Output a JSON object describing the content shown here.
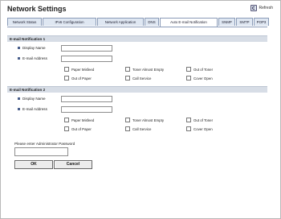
{
  "header": {
    "title": "Network Settings",
    "refresh_label": "Refresh"
  },
  "tabs": [
    {
      "label": "Network Status"
    },
    {
      "label": "IPv6 Configuration"
    },
    {
      "label": "Network Application"
    },
    {
      "label": "DNS"
    },
    {
      "label": "Auto E-mail Notification",
      "active": true
    },
    {
      "label": "SNMP"
    },
    {
      "label": "SMTP"
    },
    {
      "label": "POP3"
    }
  ],
  "notification1": {
    "title": "E-mail Notification 1",
    "display_name_label": "Display Name",
    "email_label": "E-mail Address",
    "display_name_value": "",
    "email_value": "",
    "options": {
      "paper_misfeed": "Paper Misfeed",
      "toner_almost_empty": "Toner Almost Empty",
      "out_of_toner": "Out of Toner",
      "out_of_paper": "Out of Paper",
      "call_service": "Call Service",
      "cover_open": "Cover Open"
    }
  },
  "notification2": {
    "title": "E-mail Notification 2",
    "display_name_label": "Display Name",
    "email_label": "E-mail Address",
    "display_name_value": "",
    "email_value": "",
    "options": {
      "paper_misfeed": "Paper Misfeed",
      "toner_almost_empty": "Toner Almost Empty",
      "out_of_toner": "Out of Toner",
      "out_of_paper": "Out of Paper",
      "call_service": "Call Service",
      "cover_open": "Cover Open"
    }
  },
  "password": {
    "label": "Please enter Administrator Password",
    "value": ""
  },
  "buttons": {
    "ok": "OK",
    "cancel": "Cancel"
  }
}
